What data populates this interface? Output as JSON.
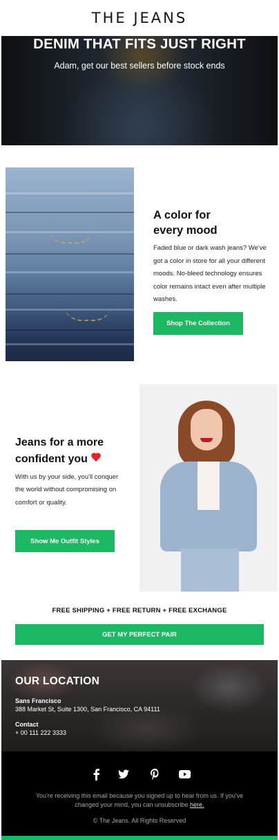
{
  "brand": {
    "name": "THE JEANS"
  },
  "hero": {
    "title": "DENIM THAT FITS JUST RIGHT",
    "subtitle": "Adam, get our best sellers before stock ends"
  },
  "section_color": {
    "title_line1": "A color for",
    "title_line2": "every mood",
    "body": "Faded blue or dark wash jeans? We've got a color in store for all your different moods. No-bleed technology ensures color remains intact even after multiple washes.",
    "button_label": "Shop The Collection"
  },
  "section_confident": {
    "title_line1": "Jeans for a more",
    "title_line2": "confident you",
    "body": "With us by your side, you'll conquer the world without compromising on comfort or quality.",
    "button_label": "Show Me Outfit Styles"
  },
  "shipping": {
    "text": "FREE SHIPPING + FREE RETURN + FREE EXCHANGE",
    "button_label": "GET MY PERFECT PAIR"
  },
  "location": {
    "title": "OUR LOCATION",
    "city": "Sans Francisco",
    "address": "388 Market St, Suite 1300, San Francisco, CA 94111",
    "contact_label": "Contact",
    "phone": "+ 00 111 222 3333"
  },
  "footer": {
    "social_icons": [
      "facebook-icon",
      "twitter-icon",
      "pinterest-icon",
      "youtube-icon"
    ],
    "legal_line1": "You're receiving this email because you signed up to hear from us. If you've",
    "legal_line2": "changed your mind, you can unsubscribe",
    "unsubscribe_link": "here.",
    "copyright": "© The Jeans. All Rights Reserved"
  },
  "colors": {
    "accent": "#1cb863",
    "heart": "#e3242b",
    "footer_bg": "#000000"
  }
}
